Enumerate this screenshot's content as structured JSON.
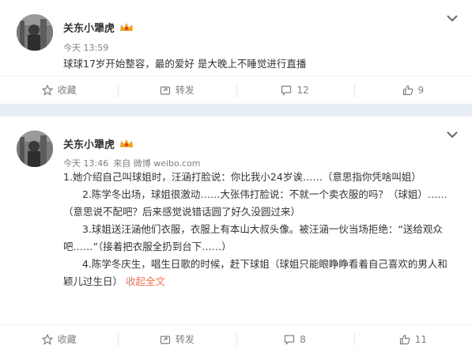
{
  "posts": [
    {
      "author": "关东小犟虎",
      "time": "今天 13:59",
      "source": "",
      "paragraphs": [
        "球球17岁开始整容，最的爱好  是大晚上不睡觉进行直播"
      ],
      "collapse_link": "",
      "actions": {
        "collect": "收藏",
        "repost": "转发",
        "comment_count": "12",
        "like_count": "9"
      }
    },
    {
      "author": "关东小犟虎",
      "time": "今天 13:46",
      "source": "来自 微博 weibo.com",
      "paragraphs": [
        "1.她介绍自己叫球姐时，汪涵打脸说：你比我小24岁诶……（意思指你凭啥叫姐）",
        "2.陈学冬出场，球姐很激动……大张伟打脸说：不就一个卖衣服的吗？（球姐）……（意思说不配吧？后来感觉说错话圆了好久没圆过来）",
        "3.球姐送汪涵他们衣服，衣服上有本山大叔头像。被汪涵一伙当场拒绝：“送给观众吧……”（接着把衣服全扔到台下……）",
        "4.陈学冬庆生，唱生日歌的时候，赶下球姐（球姐只能眼睁睁看着自己喜欢的男人和颖儿过生日）"
      ],
      "collapse_link": "收起全文",
      "actions": {
        "collect": "收藏",
        "repost": "转发",
        "comment_count": "8",
        "like_count": "11"
      }
    }
  ],
  "colors": {
    "link": "#eb7350",
    "meta": "#808080",
    "background": "#e6edf4",
    "vip_badge": "#f0a020"
  }
}
